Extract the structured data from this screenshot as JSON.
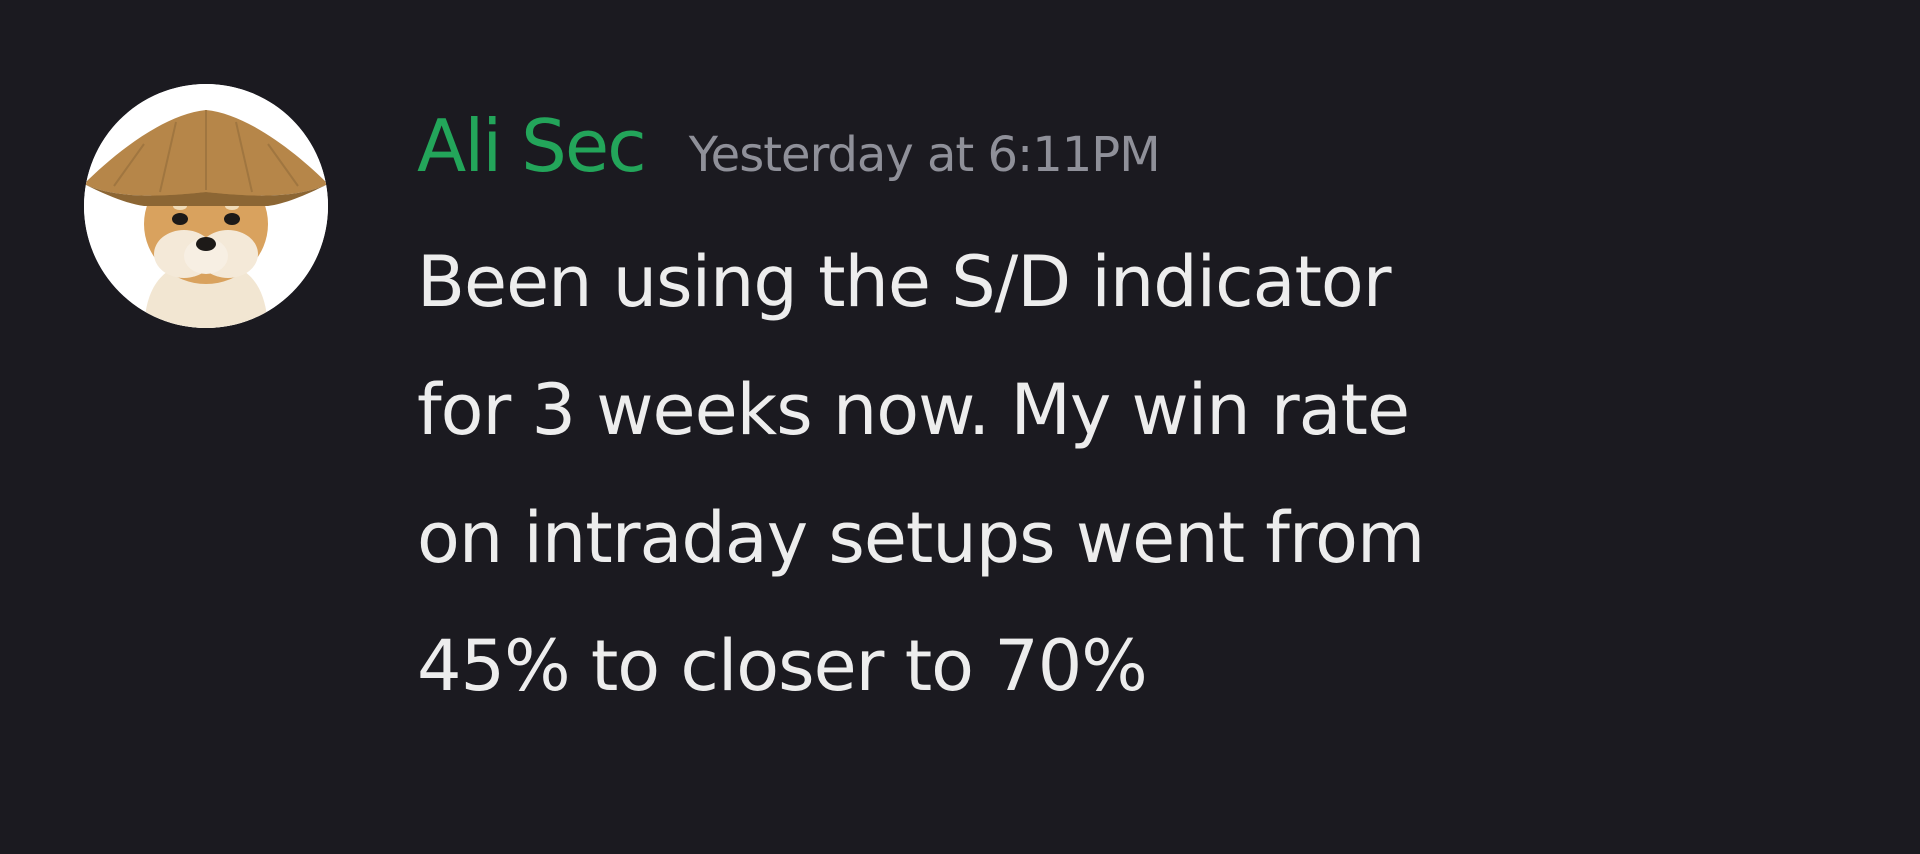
{
  "message": {
    "author": {
      "name": "Ali Sec",
      "name_color": "#23a55a",
      "avatar": "shiba-inu-conical-hat-avatar"
    },
    "timestamp": "Yesterday at 6:11PM",
    "content_lines": [
      "Been using the S/D indicator",
      "for 3 weeks now. My win rate",
      "on intraday setups went from",
      "45% to closer to 70%"
    ]
  },
  "colors": {
    "background": "#1b1a20",
    "text": "#ededed",
    "timestamp": "#8f9099"
  }
}
